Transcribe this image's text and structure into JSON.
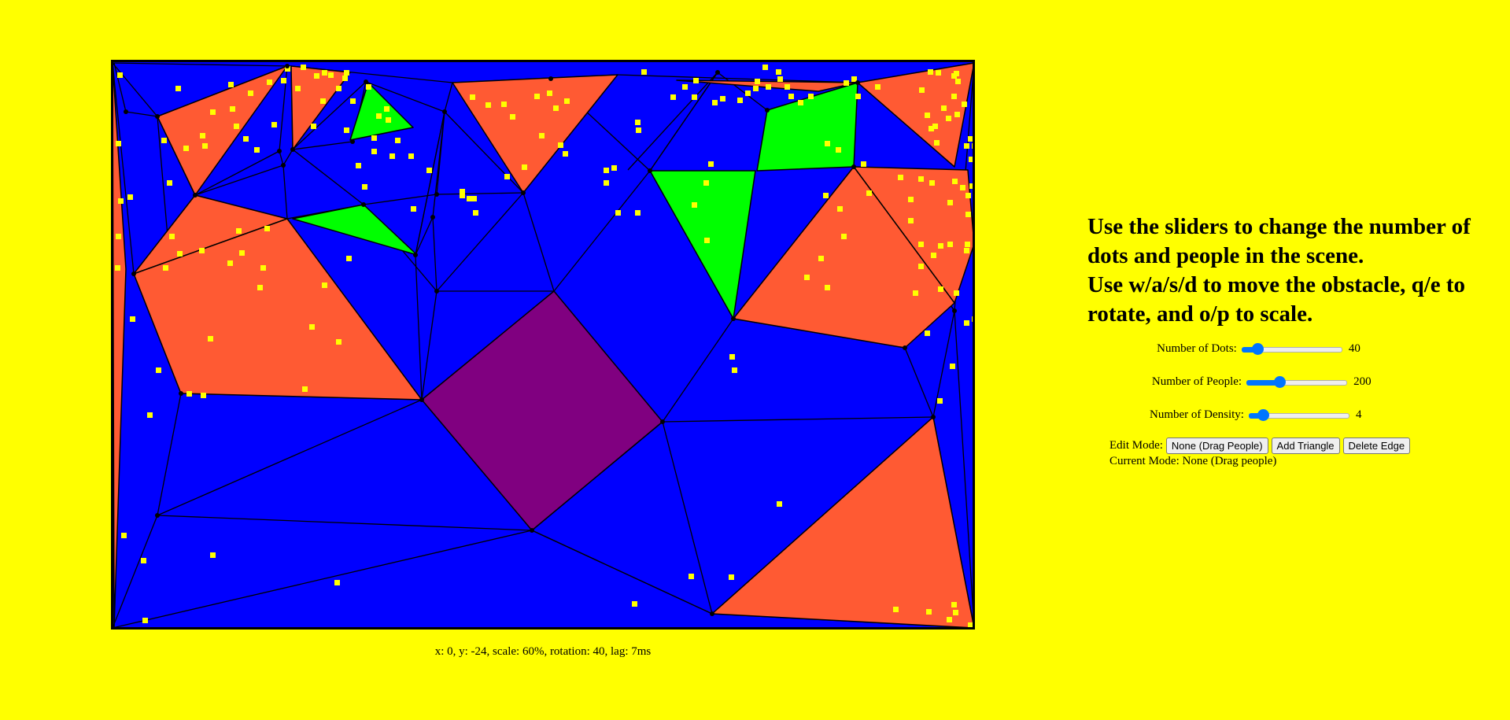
{
  "instructions": "Use the sliders to change the number of dots and people in the scene.\nUse w/a/s/d to move the obstacle, q/e to rotate, and o/p to scale.",
  "sliders": [
    {
      "label": "Number of Dots:",
      "value": "40",
      "fraction": 0.16
    },
    {
      "label": "Number of People:",
      "value": "200",
      "fraction": 0.33
    },
    {
      "label": "Number of Density:",
      "value": "4",
      "fraction": 0.14
    }
  ],
  "edit_mode": {
    "label": "Edit Mode:",
    "buttons": [
      "None (Drag People)",
      "Add Triangle",
      "Delete Edge"
    ]
  },
  "current_mode": "Current Mode: None (Drag people)",
  "status": "x: 0, y: -24, scale: 60%, rotation: 40, lag: 7ms",
  "colors": {
    "background": "#ffff00",
    "scene_fill": "#0000ff",
    "orange": "#ff5a33",
    "green": "#00ff00",
    "obstacle": "#800080",
    "person": "#ffff00",
    "edge": "#000000"
  }
}
